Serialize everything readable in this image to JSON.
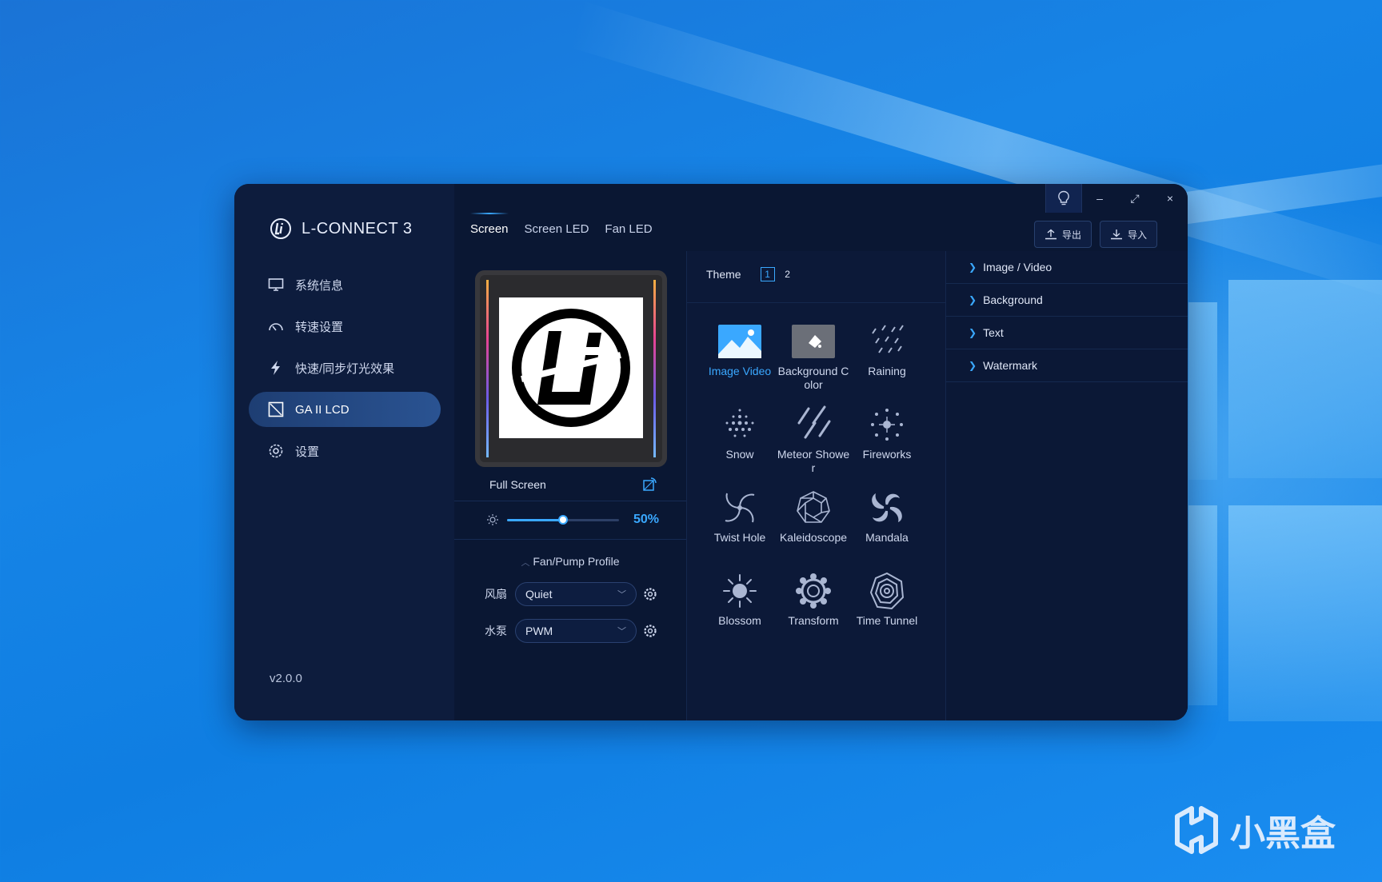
{
  "app": {
    "name": "L-CONNECT 3",
    "version": "v2.0.0"
  },
  "sidebar": {
    "items": [
      {
        "label": "系统信息",
        "icon": "monitor-icon"
      },
      {
        "label": "转速设置",
        "icon": "speedometer-icon"
      },
      {
        "label": "快速/同步灯光效果",
        "icon": "lightning-icon"
      },
      {
        "label": "GA II LCD",
        "icon": "lcd-icon",
        "active": true
      },
      {
        "label": "设置",
        "icon": "gear-icon"
      }
    ]
  },
  "tabs": [
    {
      "label": "Screen",
      "active": true
    },
    {
      "label": "Screen LED"
    },
    {
      "label": "Fan LED"
    }
  ],
  "toolbar": {
    "export_label": "导出",
    "import_label": "导入",
    "minimize": "–",
    "maximize": "⤢",
    "close": "×"
  },
  "preview": {
    "mode_label": "Full Screen",
    "brightness_percent": 50,
    "brightness_label": "50%"
  },
  "profile": {
    "title": "Fan/Pump Profile",
    "fan_label": "风扇",
    "fan_value": "Quiet",
    "pump_label": "水泵",
    "pump_value": "PWM"
  },
  "theme": {
    "title": "Theme",
    "pages": [
      "1",
      "2"
    ],
    "active_page": "1",
    "effects": [
      {
        "label": "Image Video",
        "icon": "image-icon",
        "active": true
      },
      {
        "label": "Background Color",
        "icon": "paint-bucket-icon"
      },
      {
        "label": "Raining",
        "icon": "rain-icon"
      },
      {
        "label": "Snow",
        "icon": "snow-icon"
      },
      {
        "label": "Meteor Shower",
        "icon": "meteor-icon"
      },
      {
        "label": "Fireworks",
        "icon": "fireworks-icon"
      },
      {
        "label": "Twist Hole",
        "icon": "twist-hole-icon"
      },
      {
        "label": "Kaleidoscope",
        "icon": "kaleidoscope-icon"
      },
      {
        "label": "Mandala",
        "icon": "mandala-icon"
      },
      {
        "label": "Blossom",
        "icon": "blossom-icon"
      },
      {
        "label": "Transform",
        "icon": "transform-icon"
      },
      {
        "label": "Time Tunnel",
        "icon": "time-tunnel-icon"
      }
    ]
  },
  "properties": {
    "sections": [
      "Image / Video",
      "Background",
      "Text",
      "Watermark"
    ]
  },
  "watermark": {
    "text": "小黑盒"
  },
  "colors": {
    "accent": "#3aa8ff",
    "window_bg": "#0b1a38",
    "sidebar_bg": "#0d1c3d"
  }
}
